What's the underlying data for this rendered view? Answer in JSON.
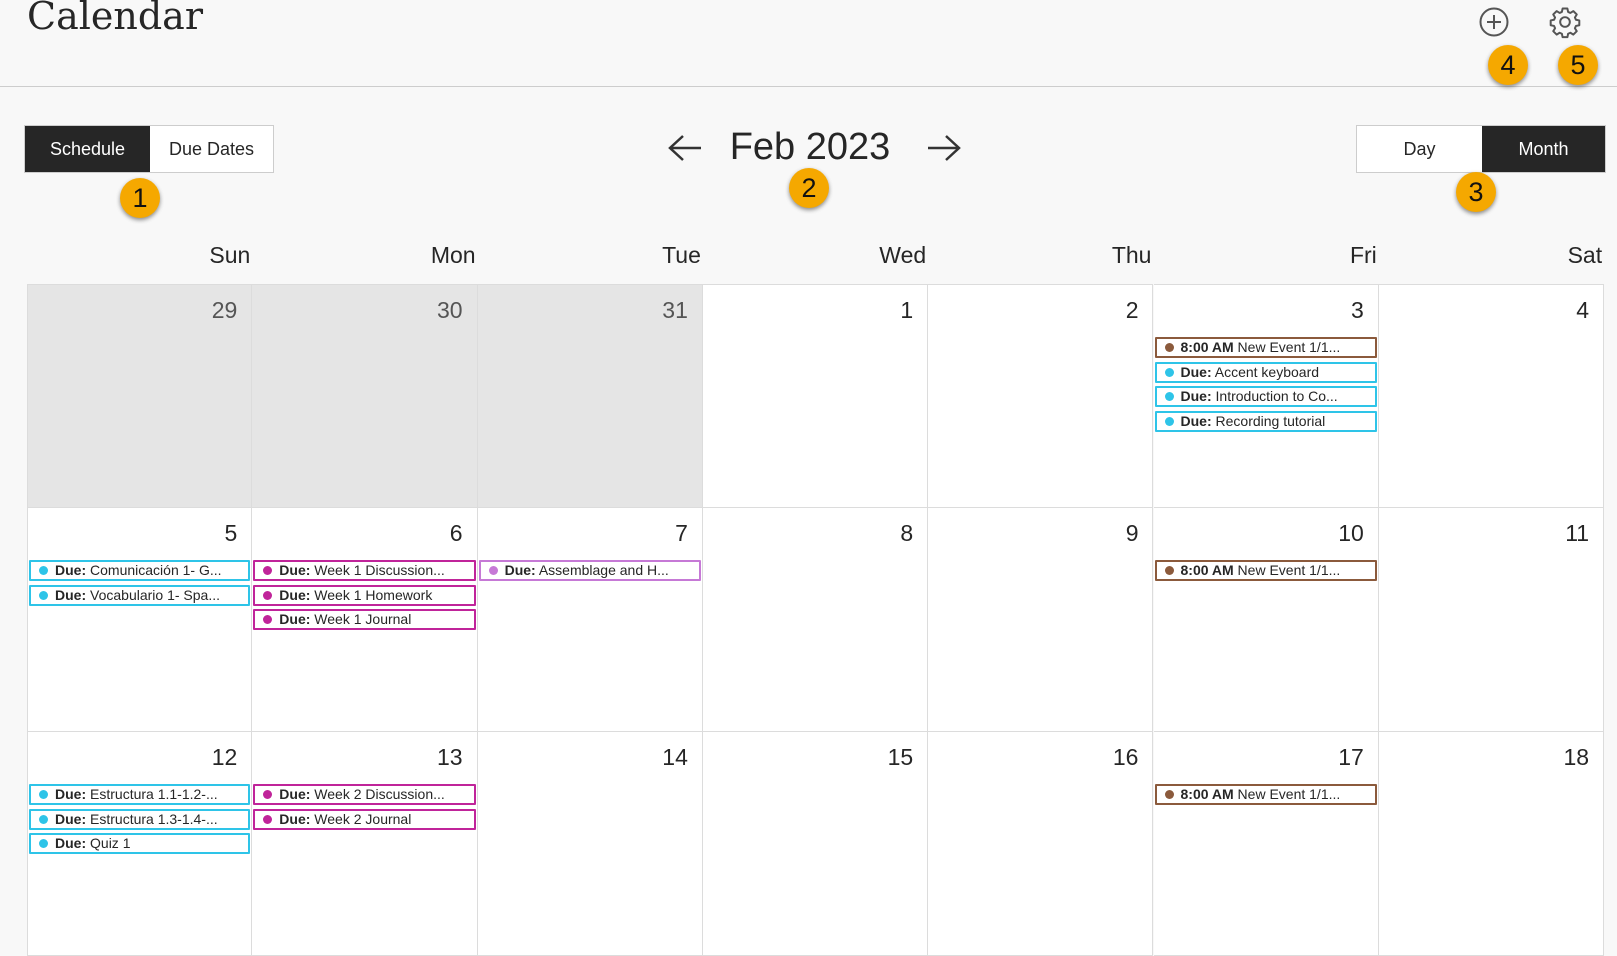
{
  "header": {
    "title": "Calendar",
    "add_icon": "plus-circle-icon",
    "settings_icon": "gear-icon"
  },
  "badges": [
    "1",
    "2",
    "3",
    "4",
    "5"
  ],
  "view_toggle": {
    "schedule": "Schedule",
    "due_dates": "Due Dates",
    "active": "schedule"
  },
  "period_toggle": {
    "day": "Day",
    "month": "Month",
    "active": "month"
  },
  "navigation": {
    "month_label": "Feb 2023",
    "prev_icon": "arrow-left-icon",
    "next_icon": "arrow-right-icon"
  },
  "weekdays": [
    "Sun",
    "Mon",
    "Tue",
    "Wed",
    "Thu",
    "Fri",
    "Sat"
  ],
  "colors": {
    "event_brown": "#8b5a3c",
    "event_cyan": "#2ec4e8",
    "event_magenta": "#c0249a",
    "event_violet": "#c679d6",
    "badge": "#f5a800",
    "active_toggle": "#262626"
  },
  "weeks": [
    [
      {
        "day": "29",
        "outside": true,
        "events": []
      },
      {
        "day": "30",
        "outside": true,
        "events": []
      },
      {
        "day": "31",
        "outside": true,
        "events": []
      },
      {
        "day": "1",
        "events": []
      },
      {
        "day": "2",
        "events": []
      },
      {
        "day": "3",
        "events": [
          {
            "prefix": "8:00 AM",
            "text": " New Event 1/1...",
            "color": "brown"
          },
          {
            "prefix": "Due:",
            "text": " Accent keyboard",
            "color": "cyan"
          },
          {
            "prefix": "Due:",
            "text": " Introduction to Co...",
            "color": "cyan"
          },
          {
            "prefix": "Due:",
            "text": " Recording tutorial",
            "color": "cyan"
          }
        ]
      },
      {
        "day": "4",
        "events": []
      }
    ],
    [
      {
        "day": "5",
        "events": [
          {
            "prefix": "Due:",
            "text": " Comunicación 1- G...",
            "color": "cyan"
          },
          {
            "prefix": "Due:",
            "text": " Vocabulario 1- Spa...",
            "color": "cyan"
          }
        ]
      },
      {
        "day": "6",
        "events": [
          {
            "prefix": "Due:",
            "text": " Week 1 Discussion...",
            "color": "magenta"
          },
          {
            "prefix": "Due:",
            "text": " Week 1 Homework",
            "color": "magenta"
          },
          {
            "prefix": "Due:",
            "text": " Week 1 Journal",
            "color": "magenta"
          }
        ]
      },
      {
        "day": "7",
        "events": [
          {
            "prefix": "Due:",
            "text": " Assemblage and H...",
            "color": "violet"
          }
        ]
      },
      {
        "day": "8",
        "events": []
      },
      {
        "day": "9",
        "events": []
      },
      {
        "day": "10",
        "events": [
          {
            "prefix": "8:00 AM",
            "text": " New Event 1/1...",
            "color": "brown"
          }
        ]
      },
      {
        "day": "11",
        "events": []
      }
    ],
    [
      {
        "day": "12",
        "events": [
          {
            "prefix": "Due:",
            "text": " Estructura 1.1-1.2-...",
            "color": "cyan"
          },
          {
            "prefix": "Due:",
            "text": " Estructura 1.3-1.4-...",
            "color": "cyan"
          },
          {
            "prefix": "Due:",
            "text": " Quiz 1",
            "color": "cyan"
          }
        ]
      },
      {
        "day": "13",
        "events": [
          {
            "prefix": "Due:",
            "text": " Week 2 Discussion...",
            "color": "magenta"
          },
          {
            "prefix": "Due:",
            "text": " Week 2 Journal",
            "color": "magenta"
          }
        ]
      },
      {
        "day": "14",
        "events": []
      },
      {
        "day": "15",
        "events": []
      },
      {
        "day": "16",
        "events": []
      },
      {
        "day": "17",
        "events": [
          {
            "prefix": "8:00 AM",
            "text": " New Event 1/1...",
            "color": "brown"
          }
        ]
      },
      {
        "day": "18",
        "events": []
      }
    ]
  ]
}
